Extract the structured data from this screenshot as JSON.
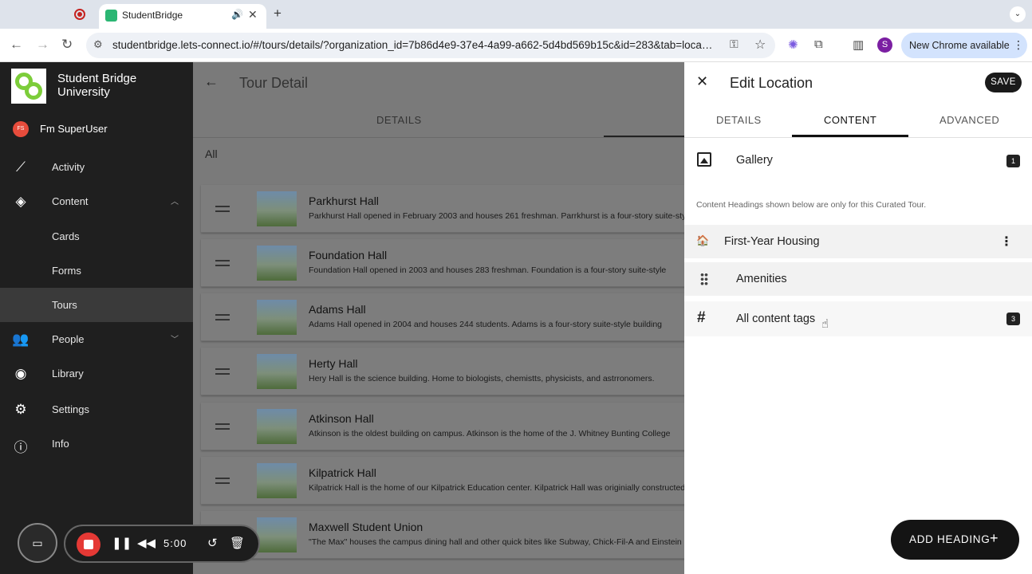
{
  "browser": {
    "tab_title": "StudentBridge",
    "url": "studentbridge.lets-connect.io/#/tours/details/?organization_id=7b86d4e9-37e4-4a99-a662-5d4bd569b15c&id=283&tab=loca…",
    "profile_initial": "S",
    "update_label": "New Chrome available"
  },
  "sidebar": {
    "org_name": "Student Bridge University",
    "user_initials": "FS",
    "user_name": "Fm SuperUser",
    "items": [
      {
        "label": "Activity",
        "icon": "activity-icon"
      },
      {
        "label": "Content",
        "icon": "layers-icon"
      },
      {
        "label": "Cards",
        "icon": ""
      },
      {
        "label": "Forms",
        "icon": ""
      },
      {
        "label": "Tours",
        "icon": ""
      },
      {
        "label": "People",
        "icon": "people-icon"
      },
      {
        "label": "Library",
        "icon": "compass-icon"
      },
      {
        "label": "Settings",
        "icon": "gear-icon"
      },
      {
        "label": "Info",
        "icon": "info-icon"
      }
    ]
  },
  "main": {
    "title": "Tour Detail",
    "tab_details": "DETAILS",
    "filter": "All",
    "locations": [
      {
        "name": "Parkhurst Hall",
        "desc": "Parkhurst Hall opened in February 2003 and houses 261 freshman. Parrkhurst is a four-story suite-style"
      },
      {
        "name": "Foundation Hall",
        "desc": "Foundation Hall opened in 2003 and houses 283 freshman. Foundation is a four-story suite-style"
      },
      {
        "name": "Adams Hall",
        "desc": "Adams Hall opened in 2004 and houses 244 students. Adams is a four-story suite-style building"
      },
      {
        "name": "Herty Hall",
        "desc": "Hery Hall is the science building. Home to biologists, chemistts, physicists, and astrronomers."
      },
      {
        "name": "Atkinson Hall",
        "desc": "Atkinson is the oldest building on campus. Atkinson is the home of the J. Whitney Bunting College"
      },
      {
        "name": "Kilpatrick Hall",
        "desc": "Kilpatrick Hall is the home of our Kilpatrick Education center. Kilpatrick Hall was originially constructed"
      },
      {
        "name": "Maxwell Student Union",
        "desc": "\"The Max\" houses the campus dining hall and other quick bites like Subway, Chick-Fil-A and Einstein"
      }
    ]
  },
  "recorder": {
    "time": "5:00"
  },
  "panel": {
    "title": "Edit Location",
    "save_label": "SAVE",
    "tabs": [
      "DETAILS",
      "CONTENT",
      "ADVANCED"
    ],
    "gallery_label": "Gallery",
    "gallery_count": "1",
    "note": "Content Headings shown below are only for this Curated Tour.",
    "heading_emoji": "🏠",
    "heading_label": "First-Year Housing",
    "sub_label": "Amenities",
    "tags_label": "All content tags",
    "tags_count": "3",
    "add_heading_label": "ADD HEADING"
  }
}
